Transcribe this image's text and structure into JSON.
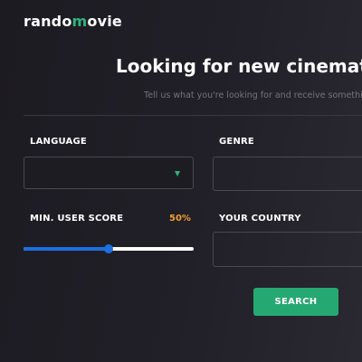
{
  "header": {
    "logo_prefix": "rando",
    "logo_accent": "m",
    "logo_suffix": "ovie"
  },
  "hero": {
    "title": "Looking for new cinematic",
    "subtitle": "Tell us what you're looking for and receive something new"
  },
  "form": {
    "language": {
      "label": "LANGUAGE",
      "value": ""
    },
    "genre": {
      "label": "GENRE",
      "value": ""
    },
    "min_user_score": {
      "label": "MIN. USER SCORE",
      "display": "50%",
      "value": 0.5
    },
    "country": {
      "label": "YOUR COUNTRY",
      "value": ""
    },
    "search_label": "SEARCH"
  },
  "colors": {
    "background": "#1f1d25",
    "accent_green": "#2fb47c",
    "button_green": "#26a872",
    "score_orange": "#f0a02c",
    "slider_blue": "#1e6fe0"
  }
}
